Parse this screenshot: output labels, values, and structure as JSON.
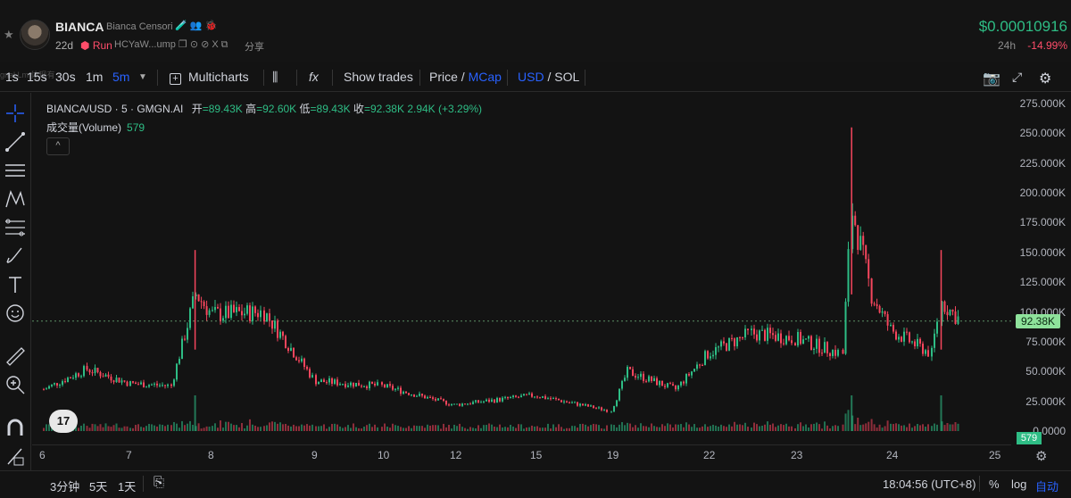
{
  "header": {
    "name": "BIANCA",
    "full_name": "Bianca Censori",
    "badges": "🧪 👥 🐞",
    "age": "22d",
    "status": "Run",
    "address": "HCYaW...ump",
    "share": "分享",
    "price": "$0.00010916",
    "change_label": "24h",
    "change": "-14.99%",
    "ghost_text": "gnal Lm   体现有"
  },
  "toolbar": {
    "intervals": [
      "1s",
      "15s",
      "30s",
      "1m",
      "5m"
    ],
    "active_interval": "5m",
    "multicharts": "Multicharts",
    "fx": "fx",
    "show_trades": "Show trades",
    "price": "Price",
    "slash1": " / ",
    "mcap": "MCap",
    "usd": "USD",
    "slash2": " / ",
    "sol": "SOL"
  },
  "legend": {
    "symbol": "BIANCA/USD · 5 · GMGN.AI",
    "open_label": "开",
    "open": "=89.43K",
    "high_label": "高",
    "high": "=92.60K",
    "low_label": "低",
    "low": "=89.43K",
    "close_label": "收",
    "close": "=92.38K",
    "change": "2.94K (+3.29%)",
    "volume_label": "成交量(Volume)",
    "volume": "579",
    "collapse": "^",
    "logo": "17"
  },
  "yaxis": {
    "ticks": [
      "275.000K",
      "250.000K",
      "225.000K",
      "200.000K",
      "175.000K",
      "150.000K",
      "125.000K",
      "100.000K",
      "75.000K",
      "50.000K",
      "25.000K",
      "0.0000"
    ],
    "last_price": "92.38K",
    "volume_tag": "579"
  },
  "xaxis": {
    "ticks": [
      "6",
      "7",
      "8",
      "9",
      "10",
      "12",
      "15",
      "19",
      "22",
      "23",
      "24",
      "25"
    ]
  },
  "bottom": {
    "ranges": [
      "3分钟",
      "5天",
      "1天"
    ],
    "time": "18:04:56 (UTC+8)",
    "percent": "%",
    "log": "log",
    "auto": "自动"
  },
  "colors": {
    "up": "#2ebd85",
    "down": "#f6465d",
    "accent": "#2962ff",
    "background": "#131313"
  },
  "chart_data": {
    "type": "candlestick",
    "title": "BIANCA/USD · 5 · GMGN.AI",
    "x_ticks": [
      "6",
      "7",
      "8",
      "9",
      "10",
      "12",
      "15",
      "19",
      "22",
      "23",
      "24",
      "25"
    ],
    "ylim": [
      0,
      275000
    ],
    "close_series": [
      {
        "x": "6",
        "y": 35000
      },
      {
        "x": "6.5",
        "y": 52000
      },
      {
        "x": "7",
        "y": 40000
      },
      {
        "x": "7.5",
        "y": 38000
      },
      {
        "x": "7.8",
        "y": 115000
      },
      {
        "x": "8",
        "y": 98000
      },
      {
        "x": "8.5",
        "y": 100000
      },
      {
        "x": "9",
        "y": 42000
      },
      {
        "x": "10",
        "y": 38000
      },
      {
        "x": "12",
        "y": 22000
      },
      {
        "x": "15",
        "y": 30000
      },
      {
        "x": "19",
        "y": 17000
      },
      {
        "x": "19.5",
        "y": 50000
      },
      {
        "x": "21",
        "y": 35000
      },
      {
        "x": "22",
        "y": 65000
      },
      {
        "x": "22.5",
        "y": 82000
      },
      {
        "x": "23",
        "y": 78000
      },
      {
        "x": "23.5",
        "y": 65000
      },
      {
        "x": "23.6",
        "y": 185000
      },
      {
        "x": "23.8",
        "y": 115000
      },
      {
        "x": "24",
        "y": 85000
      },
      {
        "x": "24.4",
        "y": 65000
      },
      {
        "x": "24.5",
        "y": 108000
      },
      {
        "x": "24.7",
        "y": 92380
      }
    ],
    "spikes": [
      {
        "x": "7.8",
        "high": 152000
      },
      {
        "x": "23.6",
        "high": 255000
      },
      {
        "x": "24.5",
        "high": 152000
      }
    ],
    "last_close": 92380
  }
}
